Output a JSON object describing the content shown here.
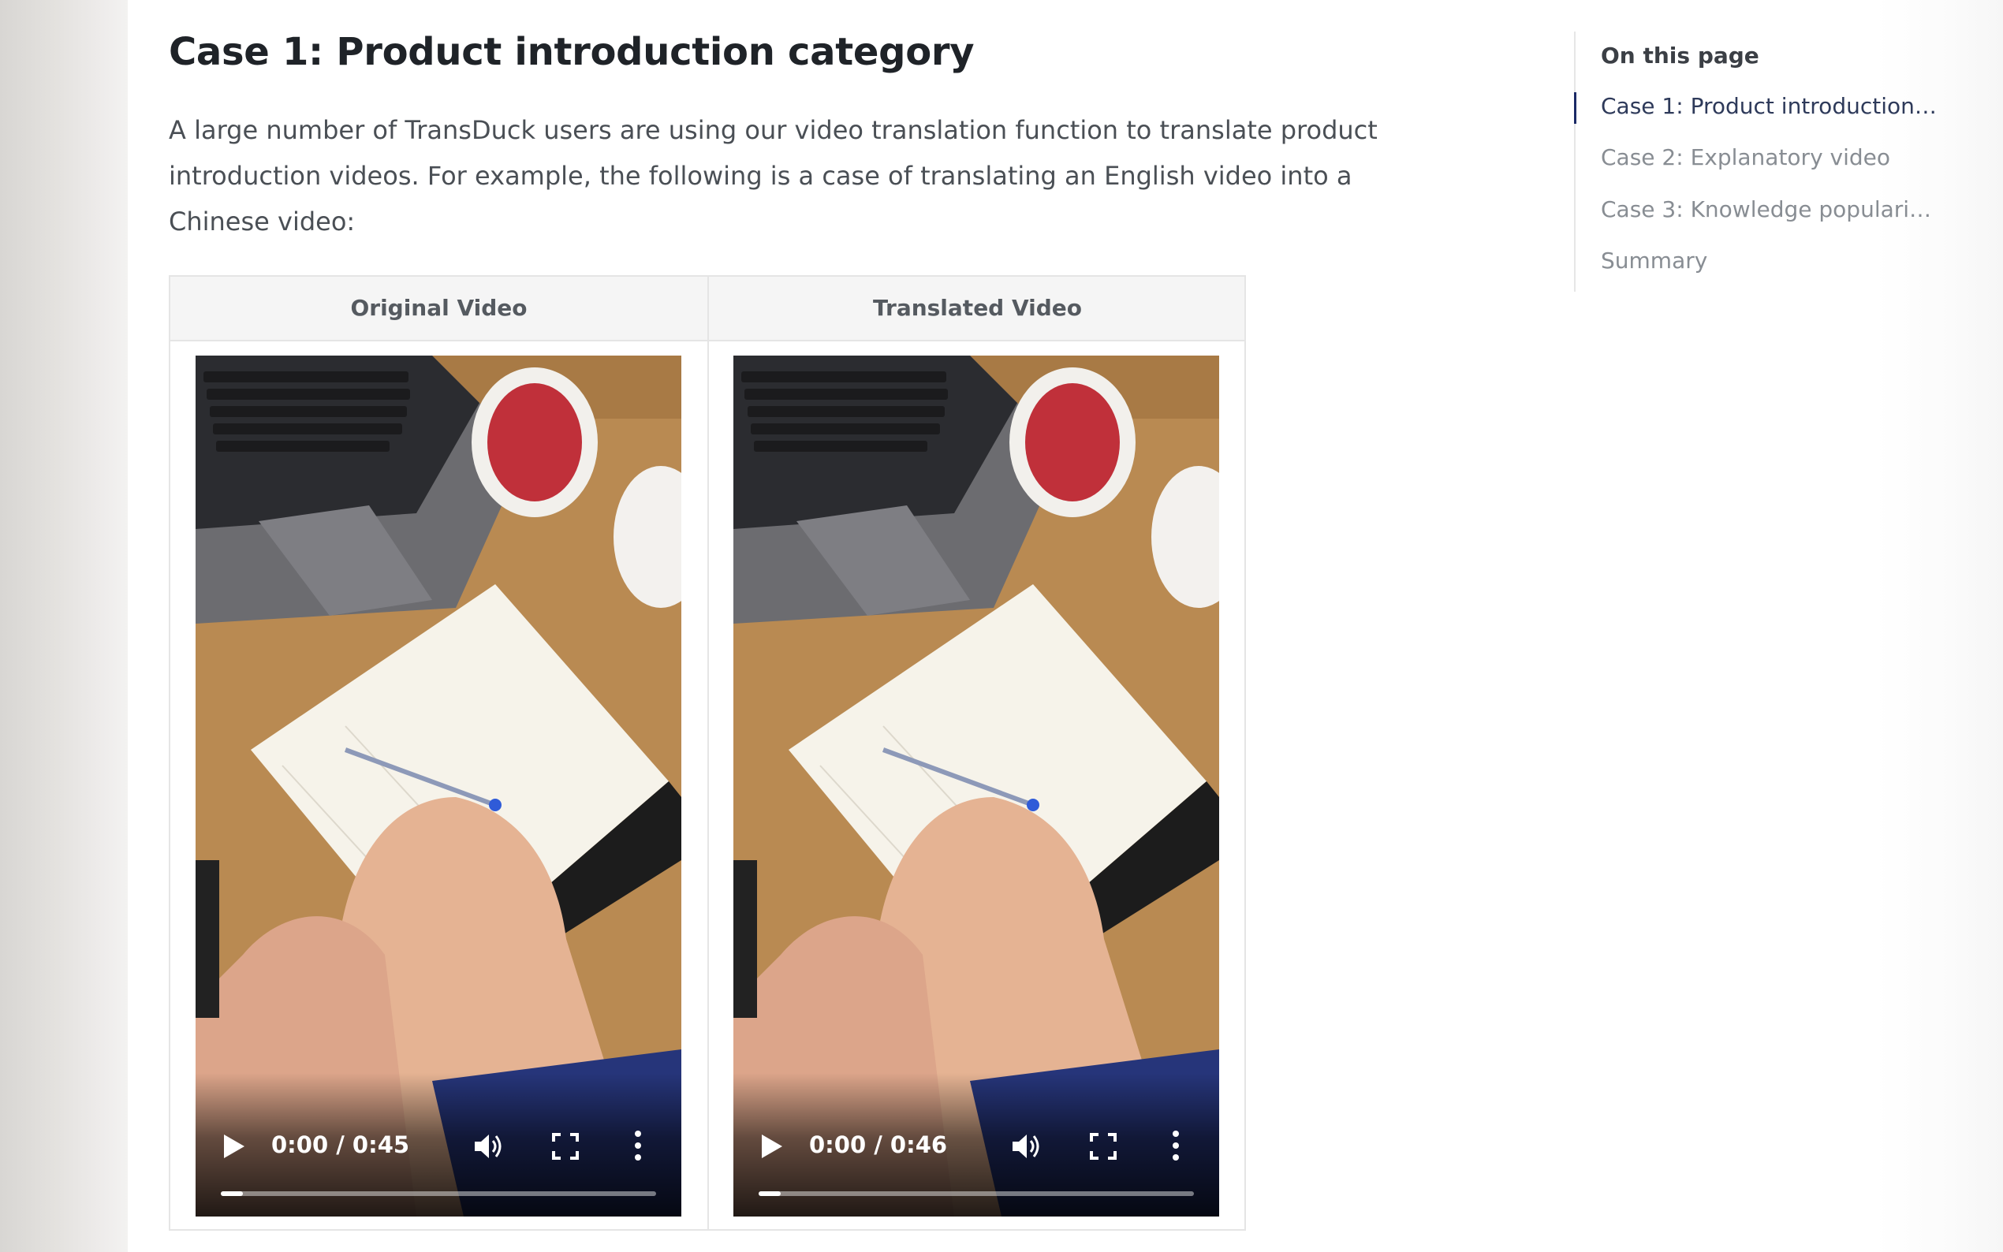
{
  "article": {
    "heading": "Case 1: Product introduction category",
    "intro": "A large number of TransDuck users are using our video translation function to translate product introduction videos. For example, the following is a case of translating an English video into a Chinese video:"
  },
  "table": {
    "headers": [
      "Original Video",
      "Translated Video"
    ],
    "videos": [
      {
        "time": "0:00 / 0:45",
        "progress": 0.05
      },
      {
        "time": "0:00 / 0:46",
        "progress": 0.05
      }
    ]
  },
  "toc": {
    "title": "On this page",
    "items": [
      {
        "label": "Case 1: Product introduction ...",
        "active": true
      },
      {
        "label": "Case 2: Explanatory video",
        "active": false
      },
      {
        "label": "Case 3: Knowledge populariz...",
        "active": false
      },
      {
        "label": "Summary",
        "active": false
      }
    ]
  },
  "icons": [
    "play-icon",
    "volume-icon",
    "fullscreen-icon",
    "more-options-icon"
  ],
  "colors": {
    "toc_active": "#1b2a66",
    "header_bg": "#f5f5f5",
    "border": "#e5e5e5"
  }
}
